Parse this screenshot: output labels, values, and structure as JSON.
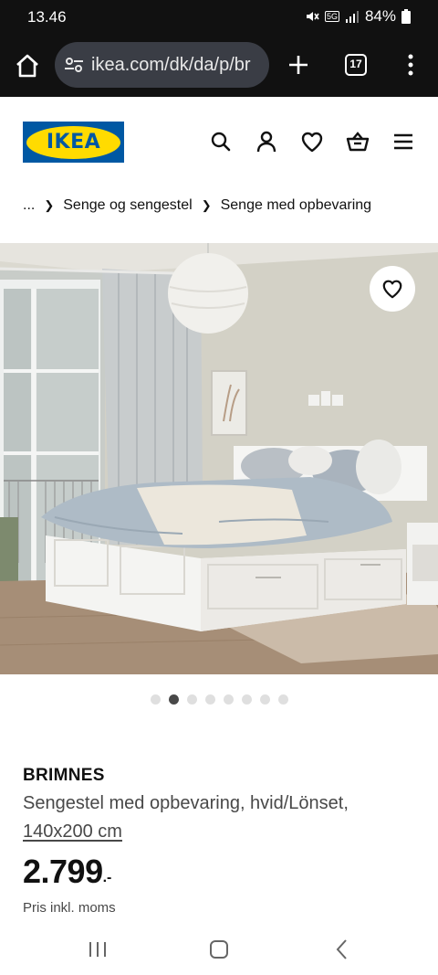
{
  "status_bar": {
    "time": "13.46",
    "network": "5G",
    "battery": "84%"
  },
  "browser": {
    "url": "ikea.com/dk/da/p/br",
    "tab_count": "17"
  },
  "header": {
    "logo_text": "IKEA",
    "brand_blue": "#0058a3",
    "brand_yellow": "#ffdb00"
  },
  "breadcrumb": {
    "ellipsis": "...",
    "items": [
      "Senge og sengestel",
      "Senge med opbevaring"
    ]
  },
  "gallery": {
    "image_count": 8,
    "active_index": 1
  },
  "product": {
    "name": "BRIMNES",
    "description": "Sengestel med opbevaring, hvid/Lönset,",
    "size": "140x200 cm",
    "price": "2.799",
    "price_suffix": ".-",
    "vat_note": "Pris inkl. moms"
  }
}
